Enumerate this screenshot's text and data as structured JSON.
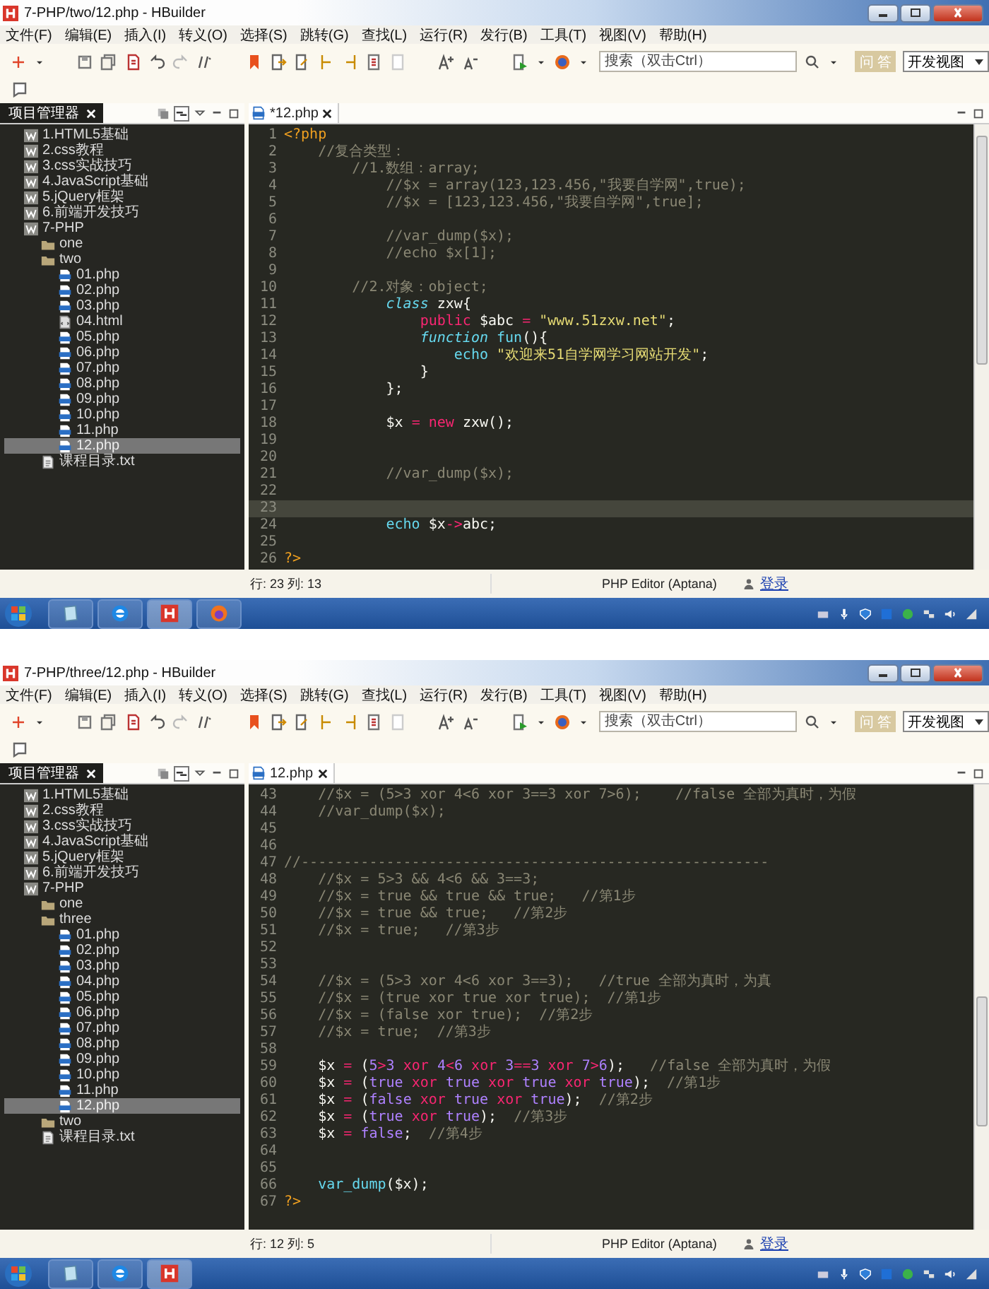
{
  "windows": [
    {
      "title": "7-PHP/two/12.php  -  HBuilder",
      "menu": [
        "文件(F)",
        "编辑(E)",
        "插入(I)",
        "转义(O)",
        "选择(S)",
        "跳转(G)",
        "查找(L)",
        "运行(R)",
        "发行(B)",
        "工具(T)",
        "视图(V)",
        "帮助(H)"
      ],
      "search": {
        "placeholder": "搜索（双击Ctrl）"
      },
      "qa_button": "问 答",
      "view_select": "开发视图",
      "sidebar": {
        "tab": "项目管理器",
        "tree": [
          {
            "label": "1.HTML5基础",
            "kind": "project",
            "selected": false
          },
          {
            "label": "2.css教程",
            "kind": "project",
            "selected": false
          },
          {
            "label": "3.css实战技巧",
            "kind": "project",
            "selected": false
          },
          {
            "label": "4.JavaScript基础",
            "kind": "project",
            "selected": false
          },
          {
            "label": "5.jQuery框架",
            "kind": "project",
            "selected": false
          },
          {
            "label": "6.前端开发技巧",
            "kind": "project",
            "selected": false
          },
          {
            "label": "7-PHP",
            "kind": "project",
            "selected": false,
            "children": [
              {
                "label": "one",
                "kind": "folder",
                "selected": false
              },
              {
                "label": "two",
                "kind": "folder",
                "selected": false,
                "children": [
                  {
                    "label": "01.php",
                    "kind": "php",
                    "selected": false
                  },
                  {
                    "label": "02.php",
                    "kind": "php",
                    "selected": false
                  },
                  {
                    "label": "03.php",
                    "kind": "php",
                    "selected": false
                  },
                  {
                    "label": "04.html",
                    "kind": "html",
                    "selected": false
                  },
                  {
                    "label": "05.php",
                    "kind": "php",
                    "selected": false
                  },
                  {
                    "label": "06.php",
                    "kind": "php",
                    "selected": false
                  },
                  {
                    "label": "07.php",
                    "kind": "php",
                    "selected": false
                  },
                  {
                    "label": "08.php",
                    "kind": "php",
                    "selected": false
                  },
                  {
                    "label": "09.php",
                    "kind": "php",
                    "selected": false
                  },
                  {
                    "label": "10.php",
                    "kind": "php",
                    "selected": false
                  },
                  {
                    "label": "11.php",
                    "kind": "php",
                    "selected": false
                  },
                  {
                    "label": "12.php",
                    "kind": "php",
                    "selected": true
                  }
                ]
              },
              {
                "label": "课程目录.txt",
                "kind": "txt",
                "selected": false
              }
            ]
          }
        ]
      },
      "editor": {
        "tab": "*12.php",
        "lines": [
          {
            "n": "1",
            "current": false,
            "tokens": [
              {
                "t": "<?php",
                "kind": "t"
              }
            ]
          },
          {
            "n": "2",
            "current": false,
            "tokens": [
              {
                "t": "    //复合类型：",
                "kind": "c"
              }
            ]
          },
          {
            "n": "3",
            "current": false,
            "tokens": [
              {
                "t": "        //1.数组：array;",
                "kind": "c"
              }
            ]
          },
          {
            "n": "4",
            "current": false,
            "tokens": [
              {
                "t": "            //$x = array(123,123.456,\"我要自学网\",true);",
                "kind": "c"
              }
            ]
          },
          {
            "n": "5",
            "current": false,
            "tokens": [
              {
                "t": "            //$x = [123,123.456,\"我要自学网\",true];",
                "kind": "c"
              }
            ]
          },
          {
            "n": "6",
            "current": false
          },
          {
            "n": "7",
            "current": false,
            "tokens": [
              {
                "t": "            //var_dump($x);",
                "kind": "c"
              }
            ]
          },
          {
            "n": "8",
            "current": false,
            "tokens": [
              {
                "t": "            //echo $x[1];",
                "kind": "c"
              }
            ]
          },
          {
            "n": "9",
            "current": false
          },
          {
            "n": "10",
            "current": false,
            "tokens": [
              {
                "t": "        //2.对象：object;",
                "kind": "c"
              }
            ]
          },
          {
            "n": "11",
            "current": false,
            "tokens": [
              {
                "t": "            class",
                "kind": "i"
              },
              {
                "t": " zxw{",
                "kind": "p"
              }
            ]
          },
          {
            "n": "12",
            "current": false,
            "tokens": [
              {
                "t": "                public",
                "kind": "k"
              },
              {
                "t": " $abc ",
                "kind": "p"
              },
              {
                "t": "=",
                "kind": "k"
              },
              {
                "t": " \"www.51zxw.net\"",
                "kind": "s"
              },
              {
                "t": ";",
                "kind": "p"
              }
            ]
          },
          {
            "n": "13",
            "current": false,
            "tokens": [
              {
                "t": "                function",
                "kind": "i"
              },
              {
                "t": " fun",
                "kind": "f"
              },
              {
                "t": "(){",
                "kind": "p"
              }
            ]
          },
          {
            "n": "14",
            "current": false,
            "tokens": [
              {
                "t": "                    echo",
                "kind": "f"
              },
              {
                "t": " \"欢迎来51自学网学习网站开发\"",
                "kind": "s"
              },
              {
                "t": ";",
                "kind": "p"
              }
            ]
          },
          {
            "n": "15",
            "current": false,
            "tokens": [
              {
                "t": "                }",
                "kind": "p"
              }
            ]
          },
          {
            "n": "16",
            "current": false,
            "tokens": [
              {
                "t": "            };",
                "kind": "p"
              }
            ]
          },
          {
            "n": "17",
            "current": false
          },
          {
            "n": "18",
            "current": false,
            "tokens": [
              {
                "t": "            $x ",
                "kind": "p"
              },
              {
                "t": "=",
                "kind": "k"
              },
              {
                "t": " new",
                "kind": "k"
              },
              {
                "t": " zxw();",
                "kind": "p"
              }
            ]
          },
          {
            "n": "19",
            "current": false
          },
          {
            "n": "20",
            "current": false
          },
          {
            "n": "21",
            "current": false,
            "tokens": [
              {
                "t": "            //var_dump($x);",
                "kind": "c"
              }
            ]
          },
          {
            "n": "22",
            "current": false
          },
          {
            "n": "23",
            "current": true
          },
          {
            "n": "24",
            "current": false,
            "tokens": [
              {
                "t": "            echo",
                "kind": "f"
              },
              {
                "t": " $x",
                "kind": "p"
              },
              {
                "t": "->",
                "kind": "k"
              },
              {
                "t": "abc;",
                "kind": "p"
              }
            ]
          },
          {
            "n": "25",
            "current": false
          },
          {
            "n": "26",
            "current": false,
            "tokens": [
              {
                "t": "?>",
                "kind": "t"
              }
            ]
          }
        ]
      },
      "status_bar": {
        "position": "行: 23 列: 13",
        "editor_mode": "PHP Editor (Aptana)",
        "login": "登录"
      },
      "taskbar": {
        "apps": [
          {
            "kind": "notepad"
          },
          {
            "kind": "ie"
          },
          {
            "kind": "hbuilder"
          },
          {
            "kind": "firefox"
          }
        ]
      }
    },
    {
      "title": "7-PHP/three/12.php  -  HBuilder",
      "menu": [
        "文件(F)",
        "编辑(E)",
        "插入(I)",
        "转义(O)",
        "选择(S)",
        "跳转(G)",
        "查找(L)",
        "运行(R)",
        "发行(B)",
        "工具(T)",
        "视图(V)",
        "帮助(H)"
      ],
      "search": {
        "placeholder": "搜索（双击Ctrl）"
      },
      "qa_button": "问 答",
      "view_select": "开发视图",
      "sidebar": {
        "tab": "项目管理器",
        "tree": [
          {
            "label": "1.HTML5基础",
            "kind": "project",
            "selected": false
          },
          {
            "label": "2.css教程",
            "kind": "project",
            "selected": false
          },
          {
            "label": "3.css实战技巧",
            "kind": "project",
            "selected": false
          },
          {
            "label": "4.JavaScript基础",
            "kind": "project",
            "selected": false
          },
          {
            "label": "5.jQuery框架",
            "kind": "project",
            "selected": false
          },
          {
            "label": "6.前端开发技巧",
            "kind": "project",
            "selected": false
          },
          {
            "label": "7-PHP",
            "kind": "project",
            "selected": false,
            "children": [
              {
                "label": "one",
                "kind": "folder",
                "selected": false
              },
              {
                "label": "three",
                "kind": "folder",
                "selected": false,
                "children": [
                  {
                    "label": "01.php",
                    "kind": "php",
                    "selected": false
                  },
                  {
                    "label": "02.php",
                    "kind": "php",
                    "selected": false
                  },
                  {
                    "label": "03.php",
                    "kind": "php",
                    "selected": false
                  },
                  {
                    "label": "04.php",
                    "kind": "php",
                    "selected": false
                  },
                  {
                    "label": "05.php",
                    "kind": "php",
                    "selected": false
                  },
                  {
                    "label": "06.php",
                    "kind": "php",
                    "selected": false
                  },
                  {
                    "label": "07.php",
                    "kind": "php",
                    "selected": false
                  },
                  {
                    "label": "08.php",
                    "kind": "php",
                    "selected": false
                  },
                  {
                    "label": "09.php",
                    "kind": "php",
                    "selected": false
                  },
                  {
                    "label": "10.php",
                    "kind": "php",
                    "selected": false
                  },
                  {
                    "label": "11.php",
                    "kind": "php",
                    "selected": false
                  },
                  {
                    "label": "12.php",
                    "kind": "php",
                    "selected": true
                  }
                ]
              },
              {
                "label": "two",
                "kind": "folder",
                "selected": false
              },
              {
                "label": "课程目录.txt",
                "kind": "txt",
                "selected": false
              }
            ]
          }
        ]
      },
      "editor": {
        "tab": "12.php",
        "lines": [
          {
            "n": "43",
            "current": false,
            "tokens": [
              {
                "t": "    //$x = (5>3 xor 4<6 xor 3==3 xor 7>6);    //false 全部为真时，为假",
                "kind": "c"
              }
            ]
          },
          {
            "n": "44",
            "current": false,
            "tokens": [
              {
                "t": "    //var_dump($x);",
                "kind": "c"
              }
            ]
          },
          {
            "n": "45",
            "current": false
          },
          {
            "n": "46",
            "current": false
          },
          {
            "n": "47",
            "current": false,
            "tokens": [
              {
                "t": "//-------------------------------------------------------",
                "kind": "c"
              }
            ]
          },
          {
            "n": "48",
            "current": false,
            "tokens": [
              {
                "t": "    //$x = 5>3 && 4<6 && 3==3;",
                "kind": "c"
              }
            ]
          },
          {
            "n": "49",
            "current": false,
            "tokens": [
              {
                "t": "    //$x = true && true && true;   //第1步",
                "kind": "c"
              }
            ]
          },
          {
            "n": "50",
            "current": false,
            "tokens": [
              {
                "t": "    //$x = true && true;   //第2步",
                "kind": "c"
              }
            ]
          },
          {
            "n": "51",
            "current": false,
            "tokens": [
              {
                "t": "    //$x = true;   //第3步",
                "kind": "c"
              }
            ]
          },
          {
            "n": "52",
            "current": false
          },
          {
            "n": "53",
            "current": false
          },
          {
            "n": "54",
            "current": false,
            "tokens": [
              {
                "t": "    //$x = (5>3 xor 4<6 xor 3==3);   //true 全部为真时，为真",
                "kind": "c"
              }
            ]
          },
          {
            "n": "55",
            "current": false,
            "tokens": [
              {
                "t": "    //$x = (true xor true xor true);  //第1步",
                "kind": "c"
              }
            ]
          },
          {
            "n": "56",
            "current": false,
            "tokens": [
              {
                "t": "    //$x = (false xor true);  //第2步",
                "kind": "c"
              }
            ]
          },
          {
            "n": "57",
            "current": false,
            "tokens": [
              {
                "t": "    //$x = true;  //第3步",
                "kind": "c"
              }
            ]
          },
          {
            "n": "58",
            "current": false
          },
          {
            "n": "59",
            "current": false,
            "tokens": [
              {
                "t": "    $x ",
                "kind": "p"
              },
              {
                "t": "=",
                "kind": "k"
              },
              {
                "t": " (",
                "kind": "p"
              },
              {
                "t": "5",
                "kind": "n"
              },
              {
                "t": ">",
                "kind": "k"
              },
              {
                "t": "3",
                "kind": "n"
              },
              {
                "t": " xor ",
                "kind": "k"
              },
              {
                "t": "4",
                "kind": "n"
              },
              {
                "t": "<",
                "kind": "k"
              },
              {
                "t": "6",
                "kind": "n"
              },
              {
                "t": " xor ",
                "kind": "k"
              },
              {
                "t": "3",
                "kind": "n"
              },
              {
                "t": "==",
                "kind": "k"
              },
              {
                "t": "3",
                "kind": "n"
              },
              {
                "t": " xor ",
                "kind": "k"
              },
              {
                "t": "7",
                "kind": "n"
              },
              {
                "t": ">",
                "kind": "k"
              },
              {
                "t": "6",
                "kind": "n"
              },
              {
                "t": ");",
                "kind": "p"
              },
              {
                "t": "   //false 全部为真时，为假",
                "kind": "c"
              }
            ]
          },
          {
            "n": "60",
            "current": false,
            "tokens": [
              {
                "t": "    $x ",
                "kind": "p"
              },
              {
                "t": "=",
                "kind": "k"
              },
              {
                "t": " (",
                "kind": "p"
              },
              {
                "t": "true",
                "kind": "n"
              },
              {
                "t": " xor ",
                "kind": "k"
              },
              {
                "t": "true",
                "kind": "n"
              },
              {
                "t": " xor ",
                "kind": "k"
              },
              {
                "t": "true",
                "kind": "n"
              },
              {
                "t": " xor ",
                "kind": "k"
              },
              {
                "t": "true",
                "kind": "n"
              },
              {
                "t": ");",
                "kind": "p"
              },
              {
                "t": "  //第1步",
                "kind": "c"
              }
            ]
          },
          {
            "n": "61",
            "current": false,
            "tokens": [
              {
                "t": "    $x ",
                "kind": "p"
              },
              {
                "t": "=",
                "kind": "k"
              },
              {
                "t": " (",
                "kind": "p"
              },
              {
                "t": "false",
                "kind": "n"
              },
              {
                "t": " xor ",
                "kind": "k"
              },
              {
                "t": "true",
                "kind": "n"
              },
              {
                "t": " xor ",
                "kind": "k"
              },
              {
                "t": "true",
                "kind": "n"
              },
              {
                "t": ");",
                "kind": "p"
              },
              {
                "t": "  //第2步",
                "kind": "c"
              }
            ]
          },
          {
            "n": "62",
            "current": false,
            "tokens": [
              {
                "t": "    $x ",
                "kind": "p"
              },
              {
                "t": "=",
                "kind": "k"
              },
              {
                "t": " (",
                "kind": "p"
              },
              {
                "t": "true",
                "kind": "n"
              },
              {
                "t": " xor ",
                "kind": "k"
              },
              {
                "t": "true",
                "kind": "n"
              },
              {
                "t": ");",
                "kind": "p"
              },
              {
                "t": "  //第3步",
                "kind": "c"
              }
            ]
          },
          {
            "n": "63",
            "current": false,
            "tokens": [
              {
                "t": "    $x ",
                "kind": "p"
              },
              {
                "t": "=",
                "kind": "k"
              },
              {
                "t": " false",
                "kind": "n"
              },
              {
                "t": ";",
                "kind": "p"
              },
              {
                "t": "  //第4步",
                "kind": "c"
              }
            ]
          },
          {
            "n": "64",
            "current": false
          },
          {
            "n": "65",
            "current": false
          },
          {
            "n": "66",
            "current": false,
            "tokens": [
              {
                "t": "    var_dump",
                "kind": "f"
              },
              {
                "t": "($x);",
                "kind": "p"
              }
            ]
          },
          {
            "n": "67",
            "current": false,
            "tokens": [
              {
                "t": "?>",
                "kind": "t"
              }
            ]
          }
        ]
      },
      "status_bar": {
        "position": "行: 12 列: 5",
        "editor_mode": "PHP Editor (Aptana)",
        "login": "登录"
      },
      "taskbar": {
        "apps": [
          {
            "kind": "notepad"
          },
          {
            "kind": "ie"
          },
          {
            "kind": "hbuilder"
          }
        ]
      }
    }
  ]
}
